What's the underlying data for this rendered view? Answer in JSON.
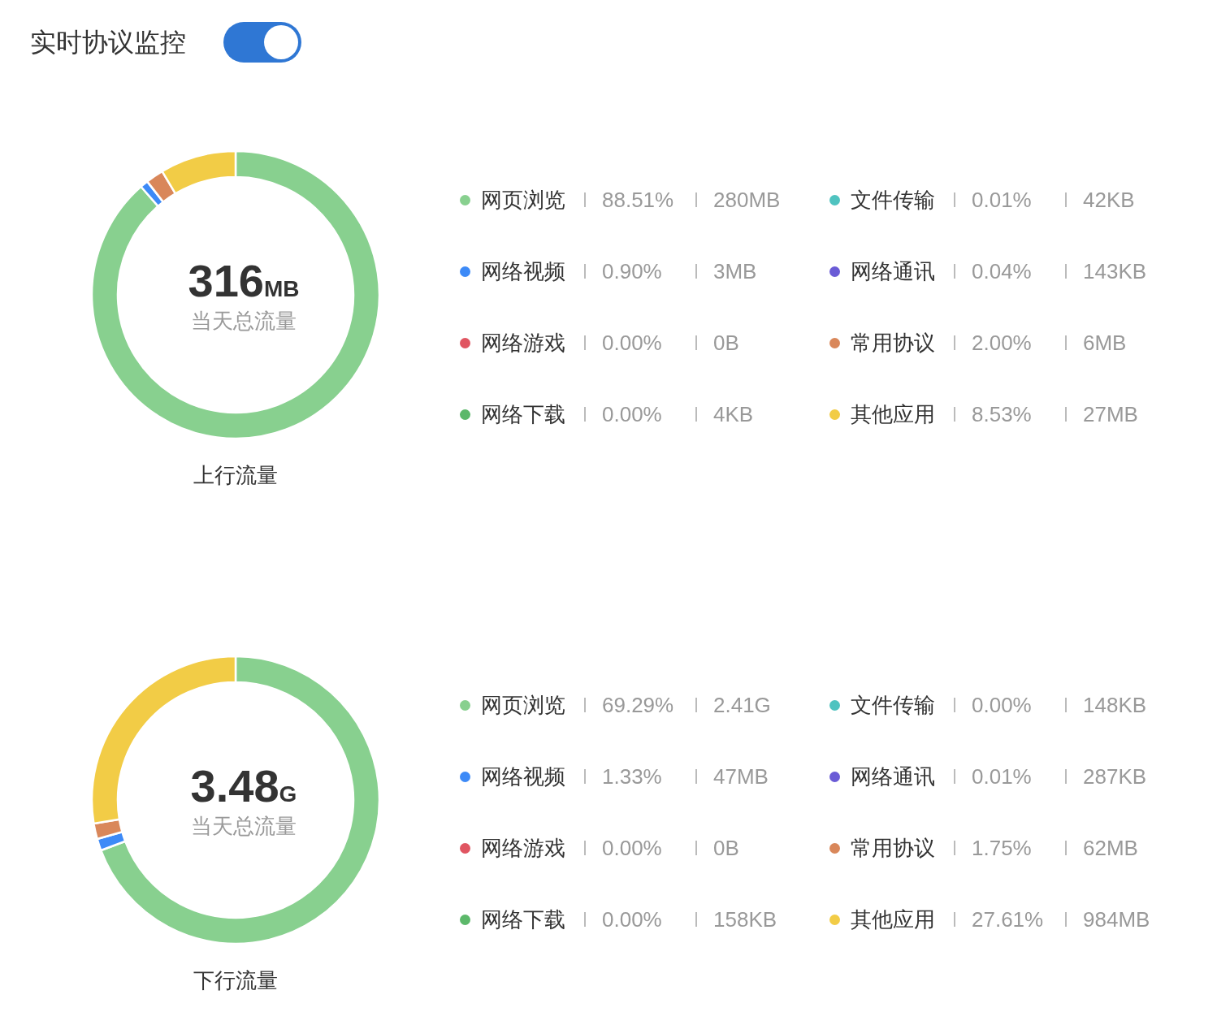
{
  "header": {
    "title": "实时协议监控",
    "toggle": {
      "on": true
    }
  },
  "sections": [
    {
      "total_value": "316",
      "total_unit": "MB",
      "total_label": "当天总流量",
      "caption": "上行流量",
      "legend": [
        {
          "name": "网页浏览",
          "percent": "88.51%",
          "amount": "280MB",
          "color": "#88d08f"
        },
        {
          "name": "网络视频",
          "percent": "0.90%",
          "amount": "3MB",
          "color": "#3d8af7"
        },
        {
          "name": "网络游戏",
          "percent": "0.00%",
          "amount": "0B",
          "color": "#e05561"
        },
        {
          "name": "网络下载",
          "percent": "0.00%",
          "amount": "4KB",
          "color": "#5cb86a"
        },
        {
          "name": "文件传输",
          "percent": "0.01%",
          "amount": "42KB",
          "color": "#4fc3c0"
        },
        {
          "name": "网络通讯",
          "percent": "0.04%",
          "amount": "143KB",
          "color": "#6a5bd6"
        },
        {
          "name": "常用协议",
          "percent": "2.00%",
          "amount": "6MB",
          "color": "#d9875a"
        },
        {
          "name": "其他应用",
          "percent": "8.53%",
          "amount": "27MB",
          "color": "#f2cc46"
        }
      ],
      "chart_data": {
        "type": "donut",
        "values": [
          88.51,
          0.9,
          2.0,
          8.53
        ],
        "colors": [
          "#88d08f",
          "#3d8af7",
          "#d9875a",
          "#f2cc46"
        ]
      }
    },
    {
      "total_value": "3.48",
      "total_unit": "G",
      "total_label": "当天总流量",
      "caption": "下行流量",
      "legend": [
        {
          "name": "网页浏览",
          "percent": "69.29%",
          "amount": "2.41G",
          "color": "#88d08f"
        },
        {
          "name": "网络视频",
          "percent": "1.33%",
          "amount": "47MB",
          "color": "#3d8af7"
        },
        {
          "name": "网络游戏",
          "percent": "0.00%",
          "amount": "0B",
          "color": "#e05561"
        },
        {
          "name": "网络下载",
          "percent": "0.00%",
          "amount": "158KB",
          "color": "#5cb86a"
        },
        {
          "name": "文件传输",
          "percent": "0.00%",
          "amount": "148KB",
          "color": "#4fc3c0"
        },
        {
          "name": "网络通讯",
          "percent": "0.01%",
          "amount": "287KB",
          "color": "#6a5bd6"
        },
        {
          "name": "常用协议",
          "percent": "1.75%",
          "amount": "62MB",
          "color": "#d9875a"
        },
        {
          "name": "其他应用",
          "percent": "27.61%",
          "amount": "984MB",
          "color": "#f2cc46"
        }
      ],
      "chart_data": {
        "type": "donut",
        "values": [
          69.29,
          1.33,
          1.75,
          27.61
        ],
        "colors": [
          "#88d08f",
          "#3d8af7",
          "#d9875a",
          "#f2cc46"
        ]
      }
    }
  ]
}
